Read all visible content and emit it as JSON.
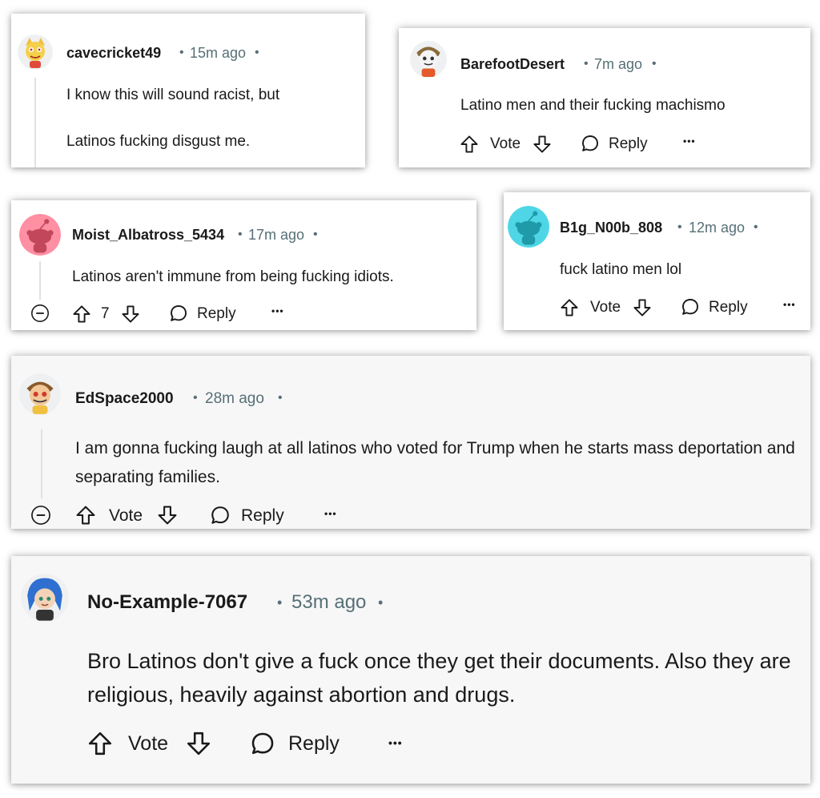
{
  "comments": [
    {
      "username": "cavecricket49",
      "separator": "•",
      "time": "15m ago",
      "trailing": "•",
      "paragraphs": [
        "I know this will sound racist, but",
        "Latinos fucking disgust me."
      ]
    },
    {
      "username": "BarefootDesert",
      "separator": "•",
      "time": "7m ago",
      "trailing": "•",
      "paragraphs": [
        "Latino men and their fucking machismo"
      ],
      "vote": "Vote",
      "reply": "Reply",
      "more": "•••"
    },
    {
      "username": "Moist_Albatross_5434",
      "separator": "•",
      "time": "17m ago",
      "trailing": "•",
      "paragraphs": [
        "Latinos aren't immune from being fucking idiots."
      ],
      "vote": "7",
      "reply": "Reply",
      "more": "•••"
    },
    {
      "username": "B1g_N00b_808",
      "separator": "•",
      "time": "12m ago",
      "trailing": "•",
      "paragraphs": [
        "fuck latino men lol"
      ],
      "vote": "Vote",
      "reply": "Reply",
      "more": "•••"
    },
    {
      "username": "EdSpace2000",
      "separator": "•",
      "time": "28m ago",
      "trailing": "•",
      "paragraphs": [
        "I am gonna fucking laugh at all latinos who voted for Trump when he starts mass deportation and separating families."
      ],
      "vote": "Vote",
      "reply": "Reply",
      "more": "•••"
    },
    {
      "username": "No-Example-7067",
      "separator": "•",
      "time": "53m ago",
      "trailing": "•",
      "paragraphs": [
        "Bro Latinos don't give a fuck once they get their documents. Also they are religious, heavily against abortion and drugs."
      ],
      "vote": "Vote",
      "reply": "Reply",
      "more": "•••"
    }
  ],
  "icons": {
    "upvote": "upvote-arrow-icon",
    "downvote": "downvote-arrow-icon",
    "reply": "speech-bubble-icon",
    "collapse": "collapse-minus-icon",
    "avatar": "snoo-avatar-icon"
  },
  "colors": {
    "text": "#1a1a1b",
    "meta": "#576f76",
    "thread_line": "#dfe1e3",
    "card_gray": "#f7f7f8",
    "avatar_pink": "#ff8fa3",
    "avatar_cyan": "#4fd6e6"
  }
}
